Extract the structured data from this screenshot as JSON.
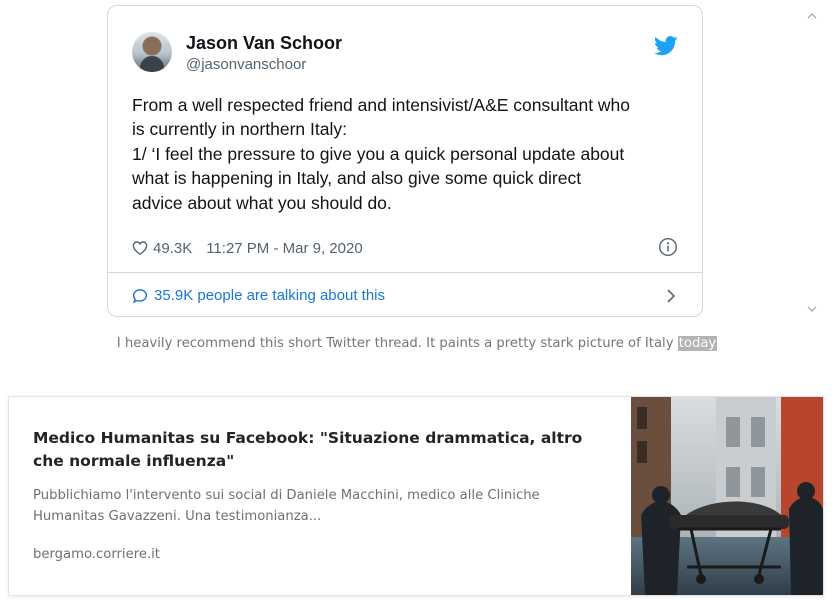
{
  "tweet": {
    "author_name": "Jason Van Schoor",
    "author_handle": "@jasonvanschoor",
    "text_lines": [
      "From a well respected friend and intensivist/A&E consultant who",
      "is currently in northern Italy:",
      "1/ ‘I feel the pressure to give you a quick personal update about",
      "what is happening in Italy, and also give some quick direct",
      "advice about what you should do."
    ],
    "likes": "49.3K",
    "timestamp": "11:27 PM - Mar 9, 2020",
    "talking": "35.9K people are talking about this",
    "icons": [
      "twitter-bird-icon",
      "heart-icon",
      "info-icon",
      "comment-bubble-icon",
      "chevron-right-icon"
    ],
    "colors": {
      "brand": "#1da1f2",
      "link": "#1b76d2",
      "border": "#cfd9de"
    }
  },
  "caption": {
    "text": "I heavily recommend this short Twitter thread. It paints a pretty stark picture of Italy ",
    "highlight": "today"
  },
  "card": {
    "title": "Medico Humanitas su Facebook: \"Situazione drammatica, altro che normale influenza\"",
    "description": "Pubblichiamo l'intervento sui social di Daniele Macchini, medico alle Cliniche Humanitas Gavazzeni. Una testimonianza...",
    "domain": "bergamo.corriere.it"
  }
}
